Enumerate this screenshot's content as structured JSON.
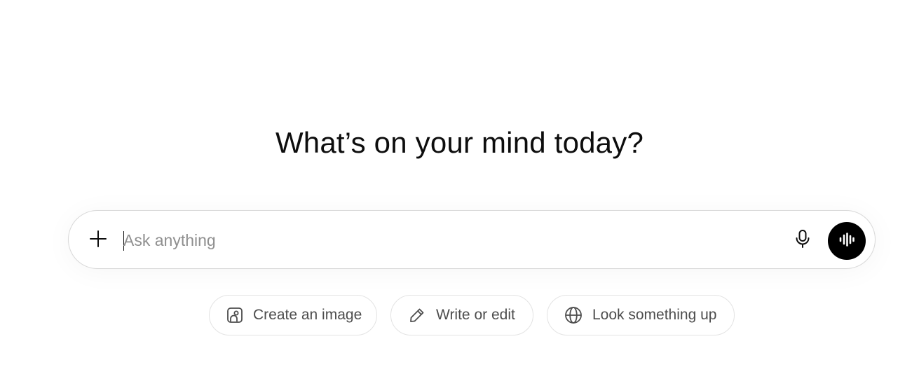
{
  "main": {
    "headline": "What’s on your mind today?"
  },
  "composer": {
    "placeholder": "Ask anything",
    "value": "",
    "icons": {
      "attach": "plus-icon",
      "dictate": "microphone-icon",
      "voice": "voice-waveform-icon"
    }
  },
  "suggestions": [
    {
      "label": "Create an image",
      "icon": "image-icon"
    },
    {
      "label": "Write or edit",
      "icon": "pencil-icon"
    },
    {
      "label": "Look something up",
      "icon": "globe-icon"
    }
  ],
  "colors": {
    "text": "#0d0d0d",
    "placeholder": "#8f8f8f",
    "voice_button": "#000000",
    "border": "#d9d9d9"
  }
}
